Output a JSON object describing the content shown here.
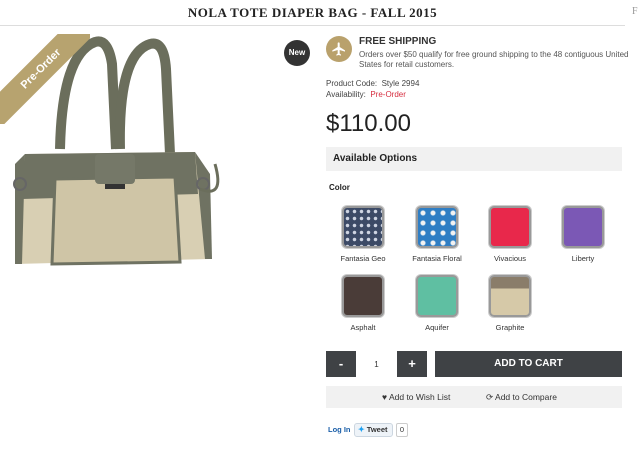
{
  "page": {
    "title": "NOLA TOTE DIAPER BAG - FALL 2015",
    "edge_letter": "F"
  },
  "product": {
    "ribbon": "Pre-Order",
    "badge": "New",
    "shipping_title": "FREE SHIPPING",
    "shipping_text": "Orders over $50 qualify for free ground shipping to the 48 contiguous United States for retail customers.",
    "code_label": "Product Code:",
    "code_value": "Style 2994",
    "availability_label": "Availability:",
    "availability_value": "Pre-Order",
    "price": "$110.00"
  },
  "options": {
    "heading": "Available Options",
    "color_label": "Color",
    "colors": [
      {
        "name": "Fantasia Geo",
        "color": "#3c4a66"
      },
      {
        "name": "Fantasia Floral",
        "color": "#2f7ec4"
      },
      {
        "name": "Vivacious",
        "color": "#e8284b"
      },
      {
        "name": "Liberty",
        "color": "#7b58b5"
      },
      {
        "name": "Asphalt",
        "color": "#4a3c38"
      },
      {
        "name": "Aquifer",
        "color": "#5fbfa2"
      },
      {
        "name": "Graphite",
        "color": "#c9b896"
      }
    ]
  },
  "cart": {
    "minus": "-",
    "qty": "1",
    "plus": "+",
    "add_label": "ADD TO CART",
    "wish_label": "Add to Wish List",
    "compare_label": "Add to Compare"
  },
  "social": {
    "login": "Log In",
    "tweet": "Tweet",
    "tweet_count": "0"
  },
  "colors": {
    "accent": "#b9a16c",
    "button": "#3f4245",
    "preorder": "#d62d3f"
  }
}
